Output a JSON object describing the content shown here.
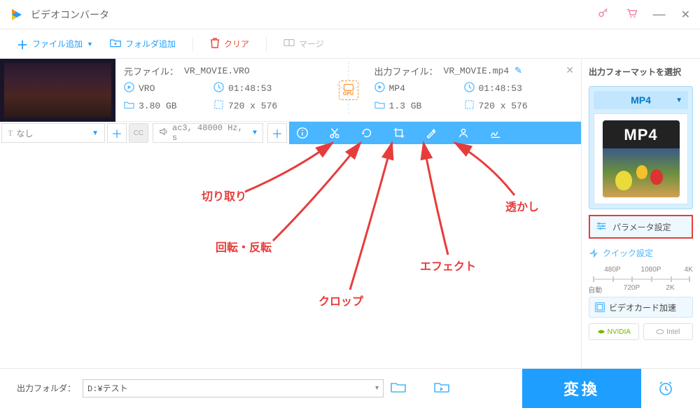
{
  "app": {
    "title": "ビデオコンバータ"
  },
  "toolbar": {
    "add_file": "ファイル追加",
    "add_folder": "フォルダ追加",
    "clear": "クリア",
    "merge": "マージ"
  },
  "file": {
    "source_label": "元ファイル：",
    "source_name": "VR_MOVIE.VRO",
    "source_format": "VRO",
    "source_duration": "01:48:53",
    "source_size": "3.80 GB",
    "source_res": "720 x 576",
    "output_label": "出力ファイル：",
    "output_name": "VR_MOVIE.mp4",
    "output_format": "MP4",
    "output_duration": "01:48:53",
    "output_size": "1.3 GB",
    "output_res": "720 x 576",
    "gpu_badge": "GPU"
  },
  "toolstrip": {
    "subtitle_sel": "なし",
    "audio_sel": "ac3, 48000 Hz, s"
  },
  "annotations": {
    "cut": "切り取り",
    "rotate": "回転・反転",
    "crop": "クロップ",
    "effect": "エフェクト",
    "watermark": "透かし"
  },
  "sidebar": {
    "title": "出力フォーマットを選択",
    "format": "MP4",
    "card_label": "MP4",
    "param_btn": "パラメータ設定",
    "quick_title": "クイック設定",
    "res": {
      "auto": "自動",
      "p480": "480P",
      "p720": "720P",
      "p1080": "1080P",
      "p2k": "2K",
      "p4k": "4K"
    },
    "gpu_accel": "ビデオカード加速",
    "vendor_nv": "NVIDIA",
    "vendor_intel": "Intel"
  },
  "bottom": {
    "out_label": "出力フォルダ：",
    "out_path": "D:¥テスト",
    "convert": "変換"
  }
}
